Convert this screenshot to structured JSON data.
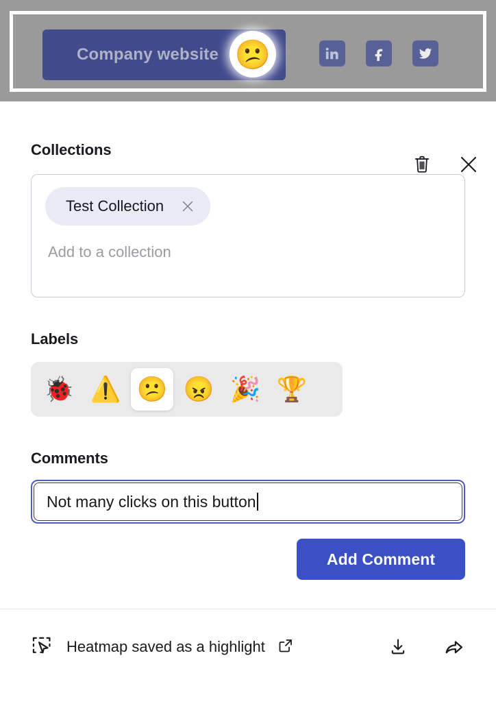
{
  "banner": {
    "cta_label": "Company website",
    "click_marker_emoji": "😕",
    "click_marker_name": "confused-face-click-marker",
    "socials": [
      {
        "name": "linkedin-icon",
        "label": "LinkedIn"
      },
      {
        "name": "facebook-icon",
        "label": "Facebook"
      },
      {
        "name": "twitter-icon",
        "label": "Twitter"
      }
    ],
    "colors": {
      "page_background": "#9a9a9a",
      "frame": "#ffffff",
      "button": "#414b8c",
      "button_text": "#aeb2c8",
      "social": "#4a5596"
    }
  },
  "panel": {
    "top_actions": [
      {
        "name": "delete-icon",
        "label": "Delete"
      },
      {
        "name": "close-icon",
        "label": "Close"
      }
    ],
    "collections": {
      "title": "Collections",
      "chips": [
        {
          "label": "Test Collection",
          "remove_label": "Remove"
        }
      ],
      "placeholder": "Add to a collection"
    },
    "labels": {
      "title": "Labels",
      "items": [
        {
          "name": "label-bug",
          "emoji": "🐞",
          "selected": false
        },
        {
          "name": "label-warning",
          "emoji": "⚠️",
          "selected": false
        },
        {
          "name": "label-confused",
          "emoji": "😕",
          "selected": true
        },
        {
          "name": "label-angry",
          "emoji": "😠",
          "selected": false
        },
        {
          "name": "label-celebrate",
          "emoji": "🎉",
          "selected": false
        },
        {
          "name": "label-trophy",
          "emoji": "🏆",
          "selected": false
        }
      ]
    },
    "comments": {
      "title": "Comments",
      "value": "Not many clicks on this button",
      "placeholder": "",
      "submit_label": "Add Comment",
      "focus_color": "#4c5bbd",
      "submit_color": "#3a50c4"
    },
    "footer": {
      "status_text": "Heatmap saved as a highlight",
      "status_icon": "selection-cursor-icon",
      "open_external_icon": "external-link-icon",
      "actions": [
        {
          "name": "download-icon",
          "label": "Download"
        },
        {
          "name": "share-icon",
          "label": "Share"
        }
      ]
    }
  }
}
